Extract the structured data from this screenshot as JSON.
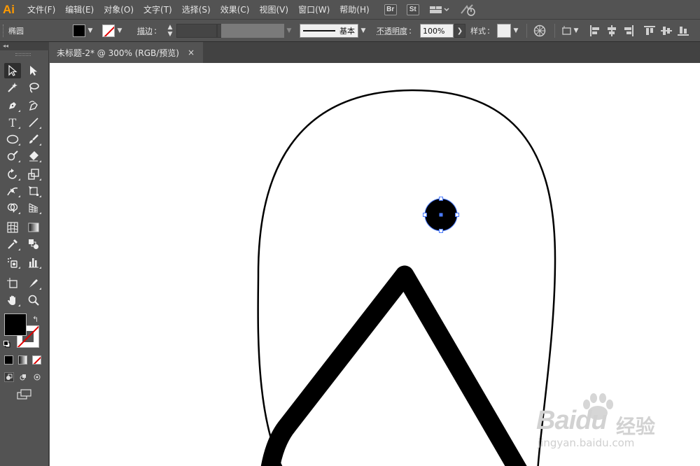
{
  "app": {
    "logo": "Ai"
  },
  "menu": [
    "文件(F)",
    "编辑(E)",
    "对象(O)",
    "文字(T)",
    "选择(S)",
    "效果(C)",
    "视图(V)",
    "窗口(W)",
    "帮助(H)"
  ],
  "app_bar": {
    "bridge_label": "Br",
    "stock_label": "St"
  },
  "control_bar": {
    "object_type": "椭圆",
    "stroke_label": "描边",
    "brush_label": "基本",
    "opacity_label": "不透明度",
    "opacity_value": "100%",
    "style_label": "样式"
  },
  "document": {
    "tab_title": "未标题-2* @ 300% (RGB/预览)",
    "close_glyph": "×"
  },
  "watermark": {
    "brand": "Baidu",
    "brand_cn": "经验",
    "url": "jingyan.baidu.com"
  },
  "colors": {
    "panel": "#535353",
    "canvas": "#ffffff",
    "selection": "#4a7bff",
    "logo": "#ff9a00"
  }
}
